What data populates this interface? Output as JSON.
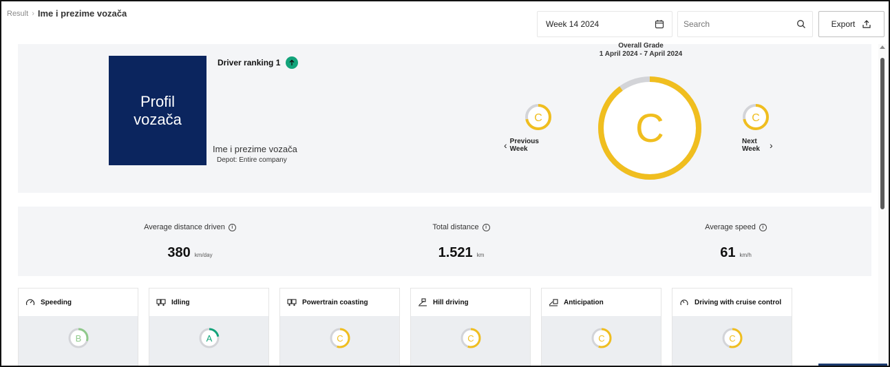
{
  "breadcrumb": {
    "root": "Result",
    "separator": "›",
    "current": "Ime i prezime vozača"
  },
  "week_picker": {
    "value": "Week 14 2024",
    "icon": "calendar-icon"
  },
  "search": {
    "placeholder": "Search",
    "icon": "search-icon"
  },
  "export": {
    "label": "Export",
    "icon": "upload-icon"
  },
  "profile": {
    "photo_text": "Profil\nvozača",
    "ranking_label": "Driver ranking 1",
    "name": "Ime i prezime vozača",
    "depot": "Depot: Entire company"
  },
  "overall": {
    "title": "Overall Grade",
    "range": "1 April 2024 - 7 April 2024",
    "grade": "C",
    "progress": 0.9,
    "previous": {
      "grade": "C",
      "label_1": "Previous",
      "label_2": "Week",
      "progress": 0.72
    },
    "next": {
      "grade": "C",
      "label_1": "Next",
      "label_2": "Week",
      "progress": 0.72
    }
  },
  "stats": [
    {
      "label": "Average distance driven",
      "value": "380",
      "unit": "km/day"
    },
    {
      "label": "Total distance",
      "value": "1.521",
      "unit": "km"
    },
    {
      "label": "Average speed",
      "value": "61",
      "unit": "km/h"
    }
  ],
  "cards": [
    {
      "label": "Speeding",
      "grade": "B",
      "icon": "speedometer-icon",
      "color": "#8fc98b",
      "progress": 0.3
    },
    {
      "label": "Idling",
      "grade": "A",
      "icon": "truck-icon",
      "color": "#12a37a",
      "progress": 0.22
    },
    {
      "label": "Powertrain coasting",
      "grade": "C",
      "icon": "truck-icon",
      "color": "#f0be1f",
      "progress": 0.55
    },
    {
      "label": "Hill driving",
      "grade": "C",
      "icon": "hill-truck-icon",
      "color": "#f0be1f",
      "progress": 0.55
    },
    {
      "label": "Anticipation",
      "grade": "C",
      "icon": "anticipation-icon",
      "color": "#f0be1f",
      "progress": 0.55
    },
    {
      "label": "Driving with cruise control",
      "grade": "C",
      "icon": "cruise-control-icon",
      "color": "#f0be1f",
      "progress": 0.55
    }
  ],
  "colors": {
    "navy": "#0b255e",
    "accent_green": "#12a37a",
    "grade_yellow": "#f0be1f",
    "ring_grey": "#d3d4d8"
  }
}
